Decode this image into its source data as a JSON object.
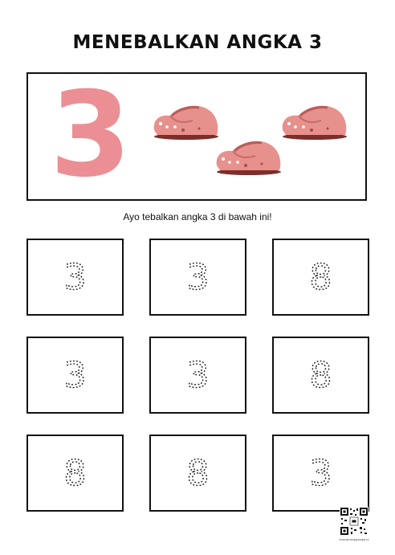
{
  "worksheet": {
    "title": "MENEBALKAN ANGKA 3",
    "example_digit": "3",
    "example_objects": [
      "shoe-icon",
      "shoe-icon",
      "shoe-icon"
    ],
    "instruction": "Ayo tebalkan angka 3 di bawah ini!",
    "tracing_cells": [
      "3",
      "3",
      "8",
      "3",
      "3",
      "8",
      "8",
      "8",
      "3"
    ],
    "footer_caption": "bonusmenjapanjar.id"
  },
  "colors": {
    "digit_pink": "#ec8f94",
    "shoe_pink": "#e7918d",
    "shoe_sole": "#7d2e2a",
    "border": "#111111"
  }
}
